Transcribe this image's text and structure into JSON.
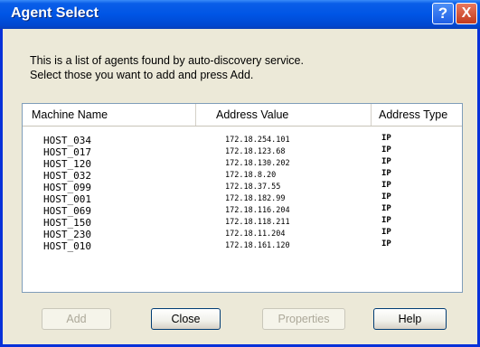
{
  "window": {
    "title": "Agent Select",
    "help_glyph": "?",
    "close_glyph": "X"
  },
  "description": {
    "line1": "This is a list of agents found by auto-discovery service.",
    "line2": "Select those you want to add and press Add."
  },
  "list": {
    "columns": [
      "Machine Name",
      "Address Value",
      "Address Type"
    ],
    "rows": [
      {
        "name": "HOST_034",
        "address": "172.18.254.101",
        "type": "IP"
      },
      {
        "name": "HOST_017",
        "address": "172.18.123.68",
        "type": "IP"
      },
      {
        "name": "HOST_120",
        "address": "172.18.130.202",
        "type": "IP"
      },
      {
        "name": "HOST_032",
        "address": "172.18.8.20",
        "type": "IP"
      },
      {
        "name": "HOST_099",
        "address": "172.18.37.55",
        "type": "IP"
      },
      {
        "name": "HOST_001",
        "address": "172.18.182.99",
        "type": "IP"
      },
      {
        "name": "HOST_069",
        "address": "172.18.116.204",
        "type": "IP"
      },
      {
        "name": "HOST_150",
        "address": "172.18.118.211",
        "type": "IP"
      },
      {
        "name": "HOST_230",
        "address": "172.18.11.204",
        "type": "IP"
      },
      {
        "name": "HOST_010",
        "address": "172.18.161.120",
        "type": "IP"
      }
    ]
  },
  "buttons": {
    "add": "Add",
    "close": "Close",
    "properties": "Properties",
    "help": "Help"
  },
  "colors": {
    "titlebar": "#0055e5",
    "dialog_bg": "#ece9d8",
    "disabled_text": "#aca899"
  }
}
